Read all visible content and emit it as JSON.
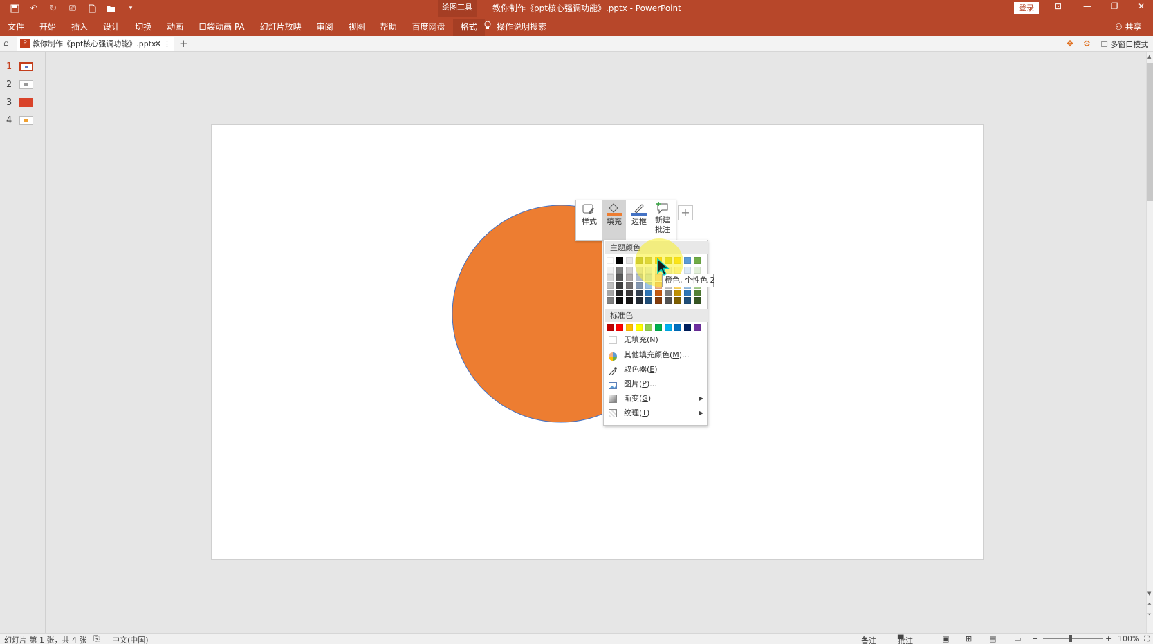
{
  "titlebar": {
    "context_tab": "绘图工具",
    "document_title": "教你制作《ppt核心强调功能》.pptx  -  PowerPoint",
    "login_label": "登录",
    "share_label": "共享",
    "tell_me": "操作说明搜索"
  },
  "ribbon_tabs": [
    "文件",
    "开始",
    "插入",
    "设计",
    "切换",
    "动画",
    "口袋动画 PA",
    "幻灯片放映",
    "审阅",
    "视图",
    "帮助",
    "百度网盘",
    "格式"
  ],
  "doc_tab": {
    "name": "教你制作《ppt核心强调功能》.pptx",
    "icon_text": "P",
    "multi_window": "多窗口模式"
  },
  "thumbnails": {
    "numbers": [
      "1",
      "2",
      "3",
      "4"
    ],
    "selected": "1"
  },
  "shape": {
    "fill_color": "#ED7D31",
    "outline_color": "#4472C4"
  },
  "mini_toolbar": {
    "style_label": "样式",
    "fill_label": "填充",
    "border_label": "边框",
    "comment_label_1": "新建",
    "comment_label_2": "批注",
    "add_symbol": "+"
  },
  "fill_palette": {
    "theme_header": "主题颜色",
    "theme_top_row": [
      "#FFFFFF",
      "#000000",
      "#E7E6E6",
      "#A6A632",
      "#BFB84B",
      "#FFC000",
      "#D6C91C",
      "#FFD400",
      "#5B9BD5",
      "#70AD47"
    ],
    "theme_columns": [
      [
        "#F2F2F2",
        "#D9D9D9",
        "#BFBFBF",
        "#A6A6A6",
        "#808080"
      ],
      [
        "#7F7F7F",
        "#595959",
        "#404040",
        "#262626",
        "#0D0D0D"
      ],
      [
        "#D0CECE",
        "#AEAAAA",
        "#757171",
        "#3B3838",
        "#171616"
      ],
      [
        "#D6DCE4",
        "#ADB9CA",
        "#8497B0",
        "#333F4F",
        "#222A35"
      ],
      [
        "#DEEBF7",
        "#BDD7EE",
        "#9DC3E6",
        "#2E75B6",
        "#1F4E79"
      ],
      [
        "#FBE5D6",
        "#F8CBAD",
        "#F4B183",
        "#C55A11",
        "#843C0C"
      ],
      [
        "#EDEDED",
        "#DBDBDB",
        "#C9C9C9",
        "#7B7B7B",
        "#525252"
      ],
      [
        "#FFF2CC",
        "#FFE699",
        "#FFD966",
        "#BF9000",
        "#7F6000"
      ],
      [
        "#DDEBF7",
        "#BDD7EE",
        "#9DC3E6",
        "#2E75B6",
        "#1F4E79"
      ],
      [
        "#E2F0D9",
        "#C5E0B4",
        "#A9D18E",
        "#538135",
        "#375623"
      ]
    ],
    "standard_header": "标准色",
    "standard_colors": [
      "#C00000",
      "#FF0000",
      "#FFC000",
      "#FFFF00",
      "#92D050",
      "#00B050",
      "#00B0F0",
      "#0070C0",
      "#002060",
      "#7030A0"
    ],
    "no_fill": "无填充(",
    "no_fill_key": "N",
    "more_colors": "其他填充颜色(",
    "more_colors_key": "M",
    "more_colors_tail": ")...",
    "eyedropper": "取色器(",
    "eyedropper_key": "E",
    "picture": "图片(",
    "picture_key": "P",
    "picture_tail": ")...",
    "gradient": "渐变(",
    "gradient_key": "G",
    "texture": "纹理(",
    "texture_key": "T",
    "close_paren": ")"
  },
  "tooltip": "橙色, 个性色 2",
  "statusbar": {
    "slide_info": "幻灯片 第 1 张，共 4 张",
    "language": "中文(中国)",
    "notes": "备注",
    "comments": "批注",
    "zoom": "100%"
  }
}
